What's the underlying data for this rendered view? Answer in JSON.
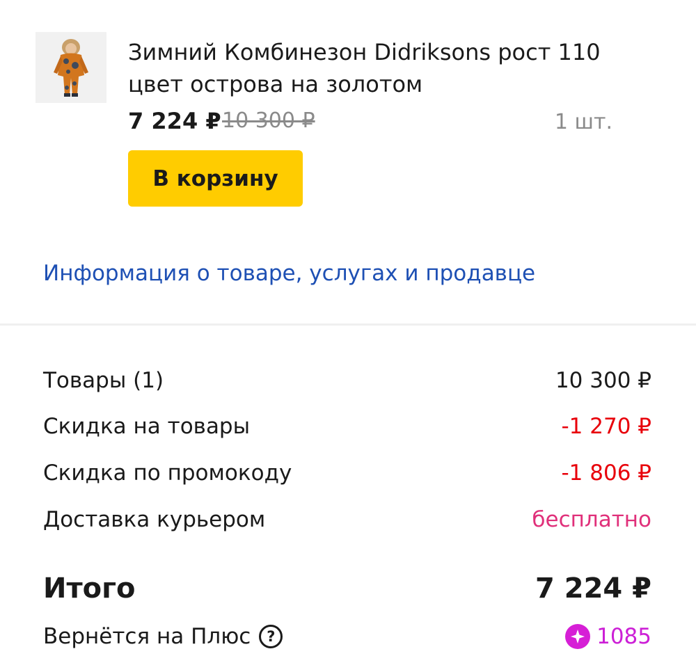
{
  "product": {
    "image_alt": "Зимний Комбинезон Didriksons",
    "title_line1": "Зимний Комбинезон Didriksons рост 110",
    "title_line2": "цвет острова на золотом",
    "price": "7 224 ₽",
    "old_price": "10 300 ₽",
    "quantity": "1 шт.",
    "cart_button_label": "В корзину",
    "info_link": "Информация о товаре, услугах и продавце"
  },
  "summary": {
    "rows": [
      {
        "label": "Товары (1)",
        "value": "10 300 ₽"
      },
      {
        "label": "Скидка на товары",
        "value": "-1 270 ₽"
      },
      {
        "label": "Скидка по промокоду",
        "value": "-1 806 ₽"
      },
      {
        "label": "Доставка курьером",
        "value": "бесплатно"
      }
    ],
    "total_label": "Итого",
    "total_value": "7 224 ₽",
    "plus_label": "Вернётся на Плюс",
    "help_icon_glyph": "?",
    "plus_points": "1085"
  },
  "colors": {
    "accent_button": "#ffcc00",
    "link": "#1e50b4",
    "discount": "#e8000a",
    "free_delivery": "#e0307a",
    "plus": "#cc1fd6"
  },
  "icons": {
    "plus": "plus-points-icon",
    "help": "question-circle-icon"
  }
}
